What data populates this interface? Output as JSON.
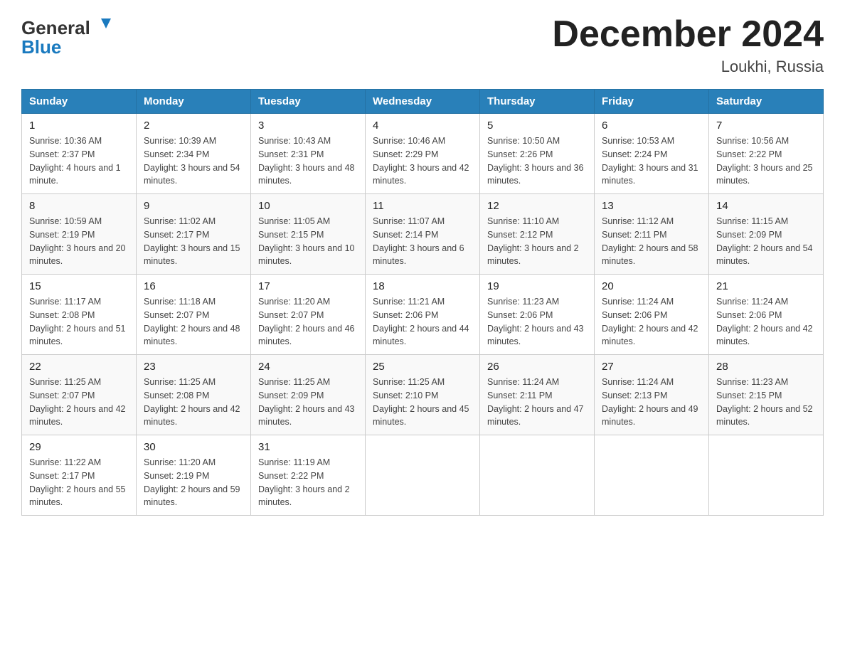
{
  "header": {
    "logo_general": "General",
    "logo_blue": "Blue",
    "title": "December 2024",
    "location": "Loukhi, Russia"
  },
  "columns": [
    "Sunday",
    "Monday",
    "Tuesday",
    "Wednesday",
    "Thursday",
    "Friday",
    "Saturday"
  ],
  "weeks": [
    [
      {
        "day": "1",
        "sunrise": "Sunrise: 10:36 AM",
        "sunset": "Sunset: 2:37 PM",
        "daylight": "Daylight: 4 hours and 1 minute."
      },
      {
        "day": "2",
        "sunrise": "Sunrise: 10:39 AM",
        "sunset": "Sunset: 2:34 PM",
        "daylight": "Daylight: 3 hours and 54 minutes."
      },
      {
        "day": "3",
        "sunrise": "Sunrise: 10:43 AM",
        "sunset": "Sunset: 2:31 PM",
        "daylight": "Daylight: 3 hours and 48 minutes."
      },
      {
        "day": "4",
        "sunrise": "Sunrise: 10:46 AM",
        "sunset": "Sunset: 2:29 PM",
        "daylight": "Daylight: 3 hours and 42 minutes."
      },
      {
        "day": "5",
        "sunrise": "Sunrise: 10:50 AM",
        "sunset": "Sunset: 2:26 PM",
        "daylight": "Daylight: 3 hours and 36 minutes."
      },
      {
        "day": "6",
        "sunrise": "Sunrise: 10:53 AM",
        "sunset": "Sunset: 2:24 PM",
        "daylight": "Daylight: 3 hours and 31 minutes."
      },
      {
        "day": "7",
        "sunrise": "Sunrise: 10:56 AM",
        "sunset": "Sunset: 2:22 PM",
        "daylight": "Daylight: 3 hours and 25 minutes."
      }
    ],
    [
      {
        "day": "8",
        "sunrise": "Sunrise: 10:59 AM",
        "sunset": "Sunset: 2:19 PM",
        "daylight": "Daylight: 3 hours and 20 minutes."
      },
      {
        "day": "9",
        "sunrise": "Sunrise: 11:02 AM",
        "sunset": "Sunset: 2:17 PM",
        "daylight": "Daylight: 3 hours and 15 minutes."
      },
      {
        "day": "10",
        "sunrise": "Sunrise: 11:05 AM",
        "sunset": "Sunset: 2:15 PM",
        "daylight": "Daylight: 3 hours and 10 minutes."
      },
      {
        "day": "11",
        "sunrise": "Sunrise: 11:07 AM",
        "sunset": "Sunset: 2:14 PM",
        "daylight": "Daylight: 3 hours and 6 minutes."
      },
      {
        "day": "12",
        "sunrise": "Sunrise: 11:10 AM",
        "sunset": "Sunset: 2:12 PM",
        "daylight": "Daylight: 3 hours and 2 minutes."
      },
      {
        "day": "13",
        "sunrise": "Sunrise: 11:12 AM",
        "sunset": "Sunset: 2:11 PM",
        "daylight": "Daylight: 2 hours and 58 minutes."
      },
      {
        "day": "14",
        "sunrise": "Sunrise: 11:15 AM",
        "sunset": "Sunset: 2:09 PM",
        "daylight": "Daylight: 2 hours and 54 minutes."
      }
    ],
    [
      {
        "day": "15",
        "sunrise": "Sunrise: 11:17 AM",
        "sunset": "Sunset: 2:08 PM",
        "daylight": "Daylight: 2 hours and 51 minutes."
      },
      {
        "day": "16",
        "sunrise": "Sunrise: 11:18 AM",
        "sunset": "Sunset: 2:07 PM",
        "daylight": "Daylight: 2 hours and 48 minutes."
      },
      {
        "day": "17",
        "sunrise": "Sunrise: 11:20 AM",
        "sunset": "Sunset: 2:07 PM",
        "daylight": "Daylight: 2 hours and 46 minutes."
      },
      {
        "day": "18",
        "sunrise": "Sunrise: 11:21 AM",
        "sunset": "Sunset: 2:06 PM",
        "daylight": "Daylight: 2 hours and 44 minutes."
      },
      {
        "day": "19",
        "sunrise": "Sunrise: 11:23 AM",
        "sunset": "Sunset: 2:06 PM",
        "daylight": "Daylight: 2 hours and 43 minutes."
      },
      {
        "day": "20",
        "sunrise": "Sunrise: 11:24 AM",
        "sunset": "Sunset: 2:06 PM",
        "daylight": "Daylight: 2 hours and 42 minutes."
      },
      {
        "day": "21",
        "sunrise": "Sunrise: 11:24 AM",
        "sunset": "Sunset: 2:06 PM",
        "daylight": "Daylight: 2 hours and 42 minutes."
      }
    ],
    [
      {
        "day": "22",
        "sunrise": "Sunrise: 11:25 AM",
        "sunset": "Sunset: 2:07 PM",
        "daylight": "Daylight: 2 hours and 42 minutes."
      },
      {
        "day": "23",
        "sunrise": "Sunrise: 11:25 AM",
        "sunset": "Sunset: 2:08 PM",
        "daylight": "Daylight: 2 hours and 42 minutes."
      },
      {
        "day": "24",
        "sunrise": "Sunrise: 11:25 AM",
        "sunset": "Sunset: 2:09 PM",
        "daylight": "Daylight: 2 hours and 43 minutes."
      },
      {
        "day": "25",
        "sunrise": "Sunrise: 11:25 AM",
        "sunset": "Sunset: 2:10 PM",
        "daylight": "Daylight: 2 hours and 45 minutes."
      },
      {
        "day": "26",
        "sunrise": "Sunrise: 11:24 AM",
        "sunset": "Sunset: 2:11 PM",
        "daylight": "Daylight: 2 hours and 47 minutes."
      },
      {
        "day": "27",
        "sunrise": "Sunrise: 11:24 AM",
        "sunset": "Sunset: 2:13 PM",
        "daylight": "Daylight: 2 hours and 49 minutes."
      },
      {
        "day": "28",
        "sunrise": "Sunrise: 11:23 AM",
        "sunset": "Sunset: 2:15 PM",
        "daylight": "Daylight: 2 hours and 52 minutes."
      }
    ],
    [
      {
        "day": "29",
        "sunrise": "Sunrise: 11:22 AM",
        "sunset": "Sunset: 2:17 PM",
        "daylight": "Daylight: 2 hours and 55 minutes."
      },
      {
        "day": "30",
        "sunrise": "Sunrise: 11:20 AM",
        "sunset": "Sunset: 2:19 PM",
        "daylight": "Daylight: 2 hours and 59 minutes."
      },
      {
        "day": "31",
        "sunrise": "Sunrise: 11:19 AM",
        "sunset": "Sunset: 2:22 PM",
        "daylight": "Daylight: 3 hours and 2 minutes."
      },
      null,
      null,
      null,
      null
    ]
  ]
}
